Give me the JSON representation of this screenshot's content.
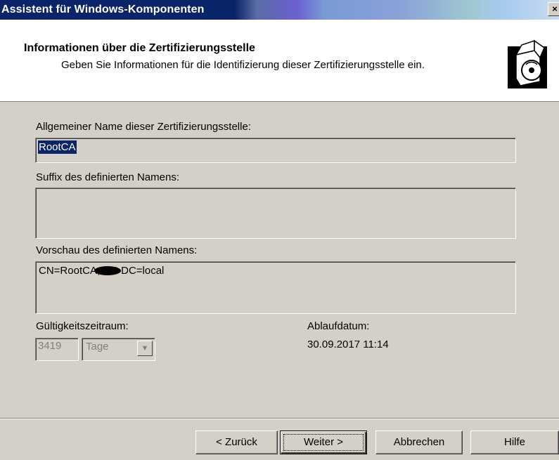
{
  "window": {
    "title": "Assistent für Windows-Komponenten",
    "close_label": "×"
  },
  "header": {
    "title": "Informationen über die Zertifizierungsstelle",
    "subtitle": "Geben Sie Informationen für die Identifizierung dieser Zertifizierungsstelle ein."
  },
  "form": {
    "common_name_label": "Allgemeiner Name dieser Zertifizierungsstelle:",
    "common_name_value": "RootCA",
    "suffix_label": "Suffix des definierten Namens:",
    "suffix_value": "",
    "preview_label": "Vorschau des definierten Namens:",
    "preview_value": "CN=RootCA, DC      DC=local",
    "validity_label": "Gültigkeitszeitraum:",
    "validity_value": "3419",
    "validity_unit": "Tage",
    "expiry_label": "Ablaufdatum:",
    "expiry_value": "30.09.2017 11:14"
  },
  "buttons": {
    "back": "< Zurück",
    "next": "Weiter >",
    "cancel": "Abbrechen",
    "help": "Hilfe"
  },
  "icons": {
    "wizard": "software-box-cd-icon",
    "dropdown": "chevron-down-icon"
  }
}
